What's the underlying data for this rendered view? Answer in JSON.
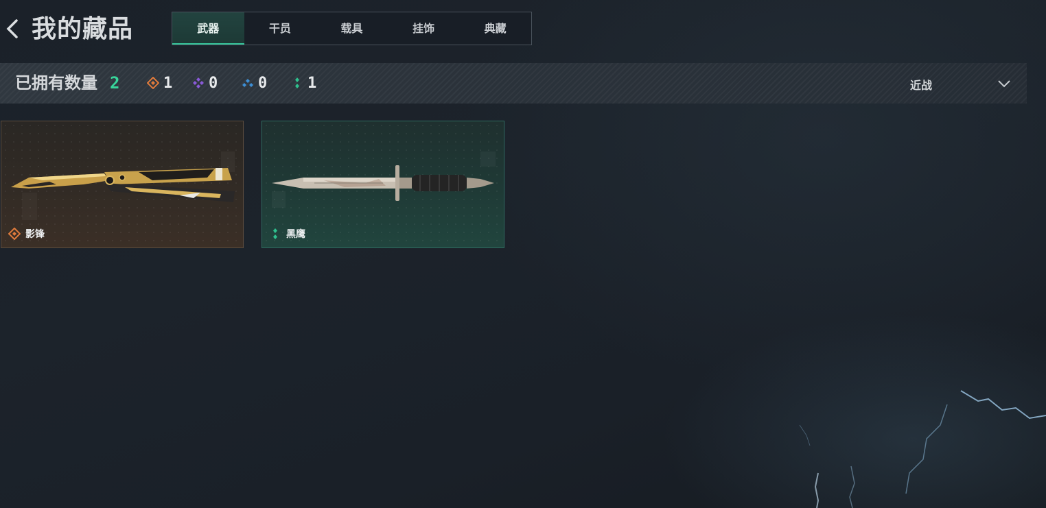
{
  "header": {
    "back_icon": "chevron-left-icon",
    "title": "我的藏品"
  },
  "tabs": [
    {
      "label": "武器",
      "active": true
    },
    {
      "label": "干员",
      "active": false
    },
    {
      "label": "载具",
      "active": false
    },
    {
      "label": "挂饰",
      "active": false
    },
    {
      "label": "典藏",
      "active": false
    }
  ],
  "summary": {
    "owned_label": "已拥有数量",
    "owned_total": "2",
    "rarity_counts": [
      {
        "icon": "orange-diamond-icon",
        "color": "#e07b3c",
        "count": "1"
      },
      {
        "icon": "purple-diamond-icon",
        "color": "#8a5ad8",
        "count": "0"
      },
      {
        "icon": "blue-diamond-icon",
        "color": "#3d8fd6",
        "count": "0"
      },
      {
        "icon": "green-diamond-icon",
        "color": "#2fc08e",
        "count": "1"
      }
    ],
    "filter": {
      "label": "近战",
      "icon": "chevron-down-icon"
    }
  },
  "items": [
    {
      "name": "影锋",
      "rarity_icon": "orange-diamond-icon",
      "rarity_color": "#e07b3c",
      "image": "butterfly-knife-icon"
    },
    {
      "name": "黑鹰",
      "rarity_icon": "green-diamond-icon",
      "rarity_color": "#2fc08e",
      "image": "combat-knife-icon"
    }
  ],
  "colors": {
    "accent": "#36c49a",
    "owned_total": "#38d49a"
  }
}
